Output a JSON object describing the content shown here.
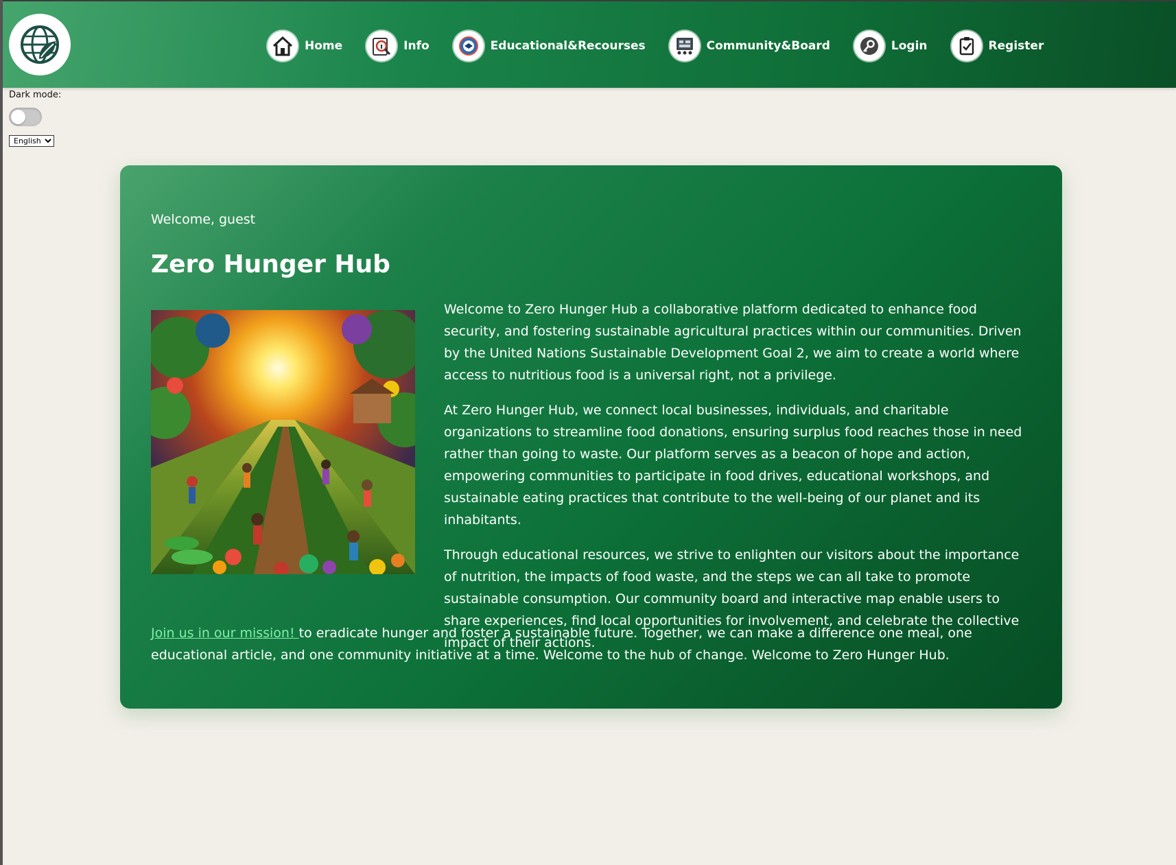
{
  "header": {
    "logo_icon": "globe-leaf-logo-icon",
    "nav": [
      {
        "label": "Home",
        "icon": "house-icon"
      },
      {
        "label": "Info",
        "icon": "magnifier-info-icon"
      },
      {
        "label": "Educational&Recourses",
        "icon": "education-badge-icon"
      },
      {
        "label": "Community&Board",
        "icon": "community-board-icon"
      },
      {
        "label": "Login",
        "icon": "login-key-icon"
      },
      {
        "label": "Register",
        "icon": "clipboard-check-icon"
      }
    ]
  },
  "settings": {
    "dark_mode_label": "Dark mode:",
    "dark_mode_on": false,
    "language_selected": "English"
  },
  "content": {
    "welcome": "Welcome, guest",
    "title": "Zero Hunger Hub",
    "hero_image": "community-garden-illustration",
    "paragraphs": [
      "Welcome to Zero Hunger Hub a collaborative platform dedicated to enhance food security, and fostering sustainable agricultural practices within our communities. Driven by the United Nations Sustainable Development Goal 2, we aim to create a world where access to nutritious food is a universal right, not a privilege.",
      "At Zero Hunger Hub, we connect local businesses, individuals, and charitable organizations to streamline food donations, ensuring surplus food reaches those in need rather than going to waste. Our platform serves as a beacon of hope and action, empowering communities to participate in food drives, educational workshops, and sustainable eating practices that contribute to the well-being of our planet and its inhabitants.",
      "Through educational resources, we strive to enlighten our visitors about the importance of nutrition, the impacts of food waste, and the steps we can all take to promote sustainable consumption. Our community board and interactive map enable users to share experiences, find local opportunities for involvement, and celebrate the collective impact of their actions."
    ],
    "closing_link": "Join us in our mission! ",
    "closing_text": "to eradicate hunger and foster a sustainable future. Together, we can make a difference one meal, one educational article, and one community initiative at a time. Welcome to the hub of change. Welcome to Zero Hunger Hub."
  },
  "colors": {
    "header_green": "#1a844a",
    "card_green": "#0d7239",
    "link_green": "#7ff0a8",
    "page_background": "#f2efe8"
  }
}
